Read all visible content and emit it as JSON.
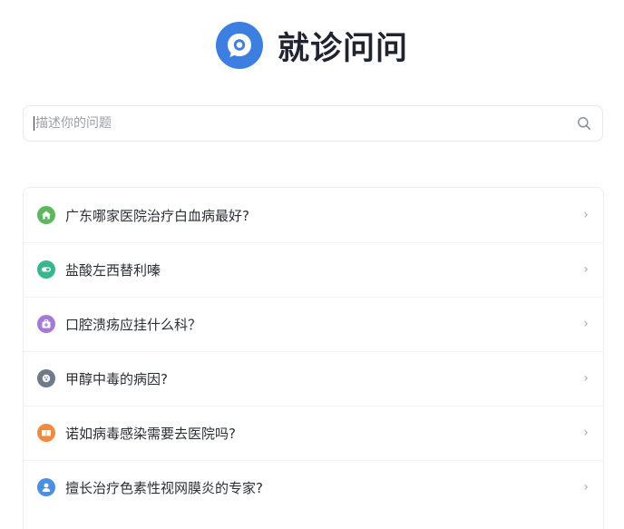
{
  "app": {
    "title": "就诊问问"
  },
  "search": {
    "placeholder": "描述你的问题",
    "value": ""
  },
  "questions": [
    {
      "label": "广东哪家医院治疗白血病最好?",
      "icon": "home-icon",
      "color": "#5cb85c"
    },
    {
      "label": "盐酸左西替利嗪",
      "icon": "capsule-icon",
      "color": "#3bb58e"
    },
    {
      "label": "口腔溃疡应挂什么科？",
      "icon": "medical-kit-icon",
      "color": "#a37ad6"
    },
    {
      "label": "甲醇中毒的病因?",
      "icon": "virus-icon",
      "color": "#6f7a8a"
    },
    {
      "label": "诺如病毒感染需要去医院吗?",
      "icon": "book-icon",
      "color": "#f08a3e"
    },
    {
      "label": "擅长治疗色素性视网膜炎的专家?",
      "icon": "user-icon",
      "color": "#4a90e2"
    }
  ],
  "chevron": "›"
}
